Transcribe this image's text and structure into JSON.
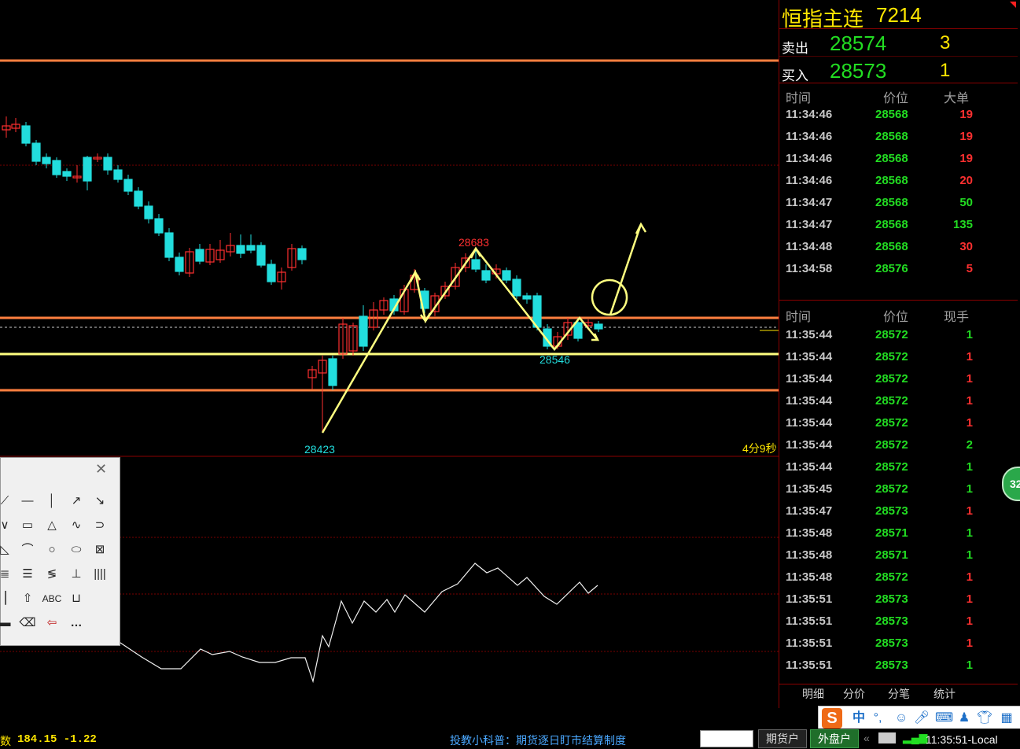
{
  "header": {
    "title": "恒指主连",
    "code": "7214"
  },
  "quote": {
    "sell": {
      "label": "卖出",
      "price": "28574",
      "volume": "3"
    },
    "buy": {
      "label": "买入",
      "price": "28573",
      "volume": "1"
    }
  },
  "big_orders": {
    "headers": [
      "时间",
      "价位",
      "大单"
    ],
    "rows": [
      {
        "time": "11:34:46",
        "price": "28568",
        "qty": "19",
        "color": "red"
      },
      {
        "time": "11:34:46",
        "price": "28568",
        "qty": "19",
        "color": "red"
      },
      {
        "time": "11:34:46",
        "price": "28568",
        "qty": "19",
        "color": "red"
      },
      {
        "time": "11:34:46",
        "price": "28568",
        "qty": "20",
        "color": "red"
      },
      {
        "time": "11:34:47",
        "price": "28568",
        "qty": "50",
        "color": "green"
      },
      {
        "time": "11:34:47",
        "price": "28568",
        "qty": "135",
        "color": "green"
      },
      {
        "time": "11:34:48",
        "price": "28568",
        "qty": "30",
        "color": "red"
      },
      {
        "time": "11:34:58",
        "price": "28576",
        "qty": "5",
        "color": "red"
      }
    ]
  },
  "trades": {
    "headers": [
      "时间",
      "价位",
      "现手"
    ],
    "rows": [
      {
        "time": "11:35:44",
        "price": "28572",
        "qty": "1",
        "color": "green"
      },
      {
        "time": "11:35:44",
        "price": "28572",
        "qty": "1",
        "color": "red"
      },
      {
        "time": "11:35:44",
        "price": "28572",
        "qty": "1",
        "color": "red"
      },
      {
        "time": "11:35:44",
        "price": "28572",
        "qty": "1",
        "color": "red"
      },
      {
        "time": "11:35:44",
        "price": "28572",
        "qty": "1",
        "color": "red"
      },
      {
        "time": "11:35:44",
        "price": "28572",
        "qty": "2",
        "color": "green"
      },
      {
        "time": "11:35:44",
        "price": "28572",
        "qty": "1",
        "color": "green"
      },
      {
        "time": "11:35:45",
        "price": "28572",
        "qty": "1",
        "color": "green"
      },
      {
        "time": "11:35:47",
        "price": "28573",
        "qty": "1",
        "color": "red"
      },
      {
        "time": "11:35:48",
        "price": "28571",
        "qty": "1",
        "color": "green"
      },
      {
        "time": "11:35:48",
        "price": "28571",
        "qty": "1",
        "color": "green"
      },
      {
        "time": "11:35:48",
        "price": "28572",
        "qty": "1",
        "color": "red"
      },
      {
        "time": "11:35:51",
        "price": "28573",
        "qty": "1",
        "color": "red"
      },
      {
        "time": "11:35:51",
        "price": "28573",
        "qty": "1",
        "color": "red"
      },
      {
        "time": "11:35:51",
        "price": "28573",
        "qty": "1",
        "color": "red"
      },
      {
        "time": "11:35:51",
        "price": "28573",
        "qty": "1",
        "color": "green"
      }
    ]
  },
  "tabs": [
    "明细",
    "分价",
    "分笔",
    "统计"
  ],
  "chart": {
    "labels": {
      "high": "28683",
      "low": "28423",
      "mid_low": "28546",
      "countdown": "4分9秒"
    }
  },
  "status": {
    "indicator_values": "184.15 -1.22",
    "indicator_prefix": "数",
    "notice": "投教小科普：期货逐日盯市结算制度",
    "btn_futures": "期货户",
    "btn_outer": "外盘户",
    "clock": "11:35:51-Local"
  },
  "badge": {
    "text": "32"
  },
  "ime": {
    "lang": "中"
  },
  "colors": {
    "up": "#ff3030",
    "down": "#22dddd",
    "resistance": "#ff7f3f",
    "support": "#ffff80",
    "annotation": "#ffff80",
    "price_up": "#22dd22"
  },
  "icons": [
    "sogou-icon",
    "mic-icon",
    "keyboard-icon",
    "shirt-icon",
    "grid-icon"
  ]
}
